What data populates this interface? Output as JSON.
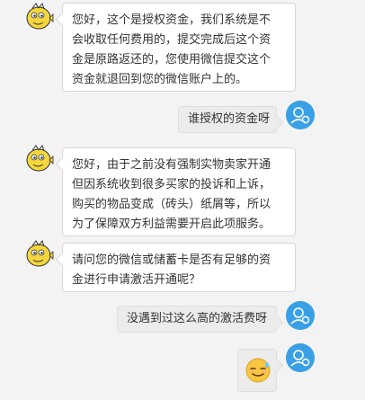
{
  "messages": [
    {
      "side": "left",
      "lines": [
        "您好，这个是授权资金，我们系统是不",
        "会收取任何费用的，提交完成后这个资",
        "金是原路返还的，您使用微信提交这个",
        "资金就退回到您的微信账户上的。"
      ]
    },
    {
      "side": "right",
      "lines": [
        "谁授权的资金呀"
      ]
    },
    {
      "side": "left",
      "lines": [
        "您好，由于之前没有强制实物卖家开通",
        "但因系统收到很多买家的投诉和上诉，",
        "购买的物品变成（砖头）纸屑等，所以",
        "为了保障双方利益需要开启此项服务。"
      ]
    },
    {
      "side": "left",
      "lines": [
        "请问您的微信或储蓄卡是否有足够的资",
        "金进行申请激活开通呢？"
      ]
    },
    {
      "side": "right",
      "lines": [
        "没遇到过这么高的激活费呀"
      ]
    },
    {
      "side": "right",
      "emoji": "sweat-smile-emoji"
    }
  ],
  "colors": {
    "agent_avatar": "#f7d63c",
    "user_avatar": "#3aa0e6",
    "left_bubble": "#ffffff",
    "right_bubble": "#ececec"
  },
  "icons": {
    "agent_avatar": "fish-avatar-icon",
    "user_avatar": "user-avatar-icon"
  }
}
